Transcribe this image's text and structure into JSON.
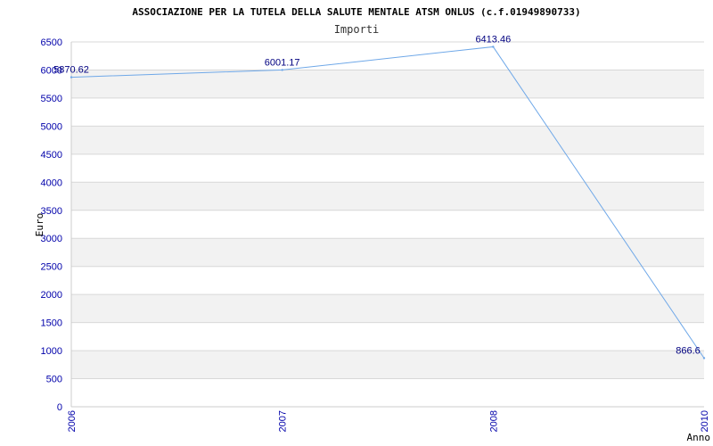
{
  "chart_data": {
    "type": "line",
    "title": "ASSOCIAZIONE PER LA TUTELA DELLA SALUTE MENTALE ATSM ONLUS (c.f.01949890733)",
    "subtitle": "Importi",
    "xlabel": "Anno",
    "ylabel": "Euro",
    "categories": [
      "2006",
      "2007",
      "2008",
      "2010"
    ],
    "series": [
      {
        "values": [
          5870.62,
          6001.17,
          6413.46,
          866.6
        ],
        "labels": [
          "5870.62",
          "6001.17",
          "6413.46",
          "866.6"
        ],
        "color": "#6fa8e8"
      }
    ],
    "ylim": [
      0,
      6500
    ],
    "yticks": [
      0,
      500,
      1000,
      1500,
      2000,
      2500,
      3000,
      3500,
      4000,
      4500,
      5000,
      5500,
      6000,
      6500
    ],
    "grid": true,
    "band_color": "#f2f2f2",
    "gridline_color": "#d8d8d8",
    "tick_color": "#0000aa"
  }
}
